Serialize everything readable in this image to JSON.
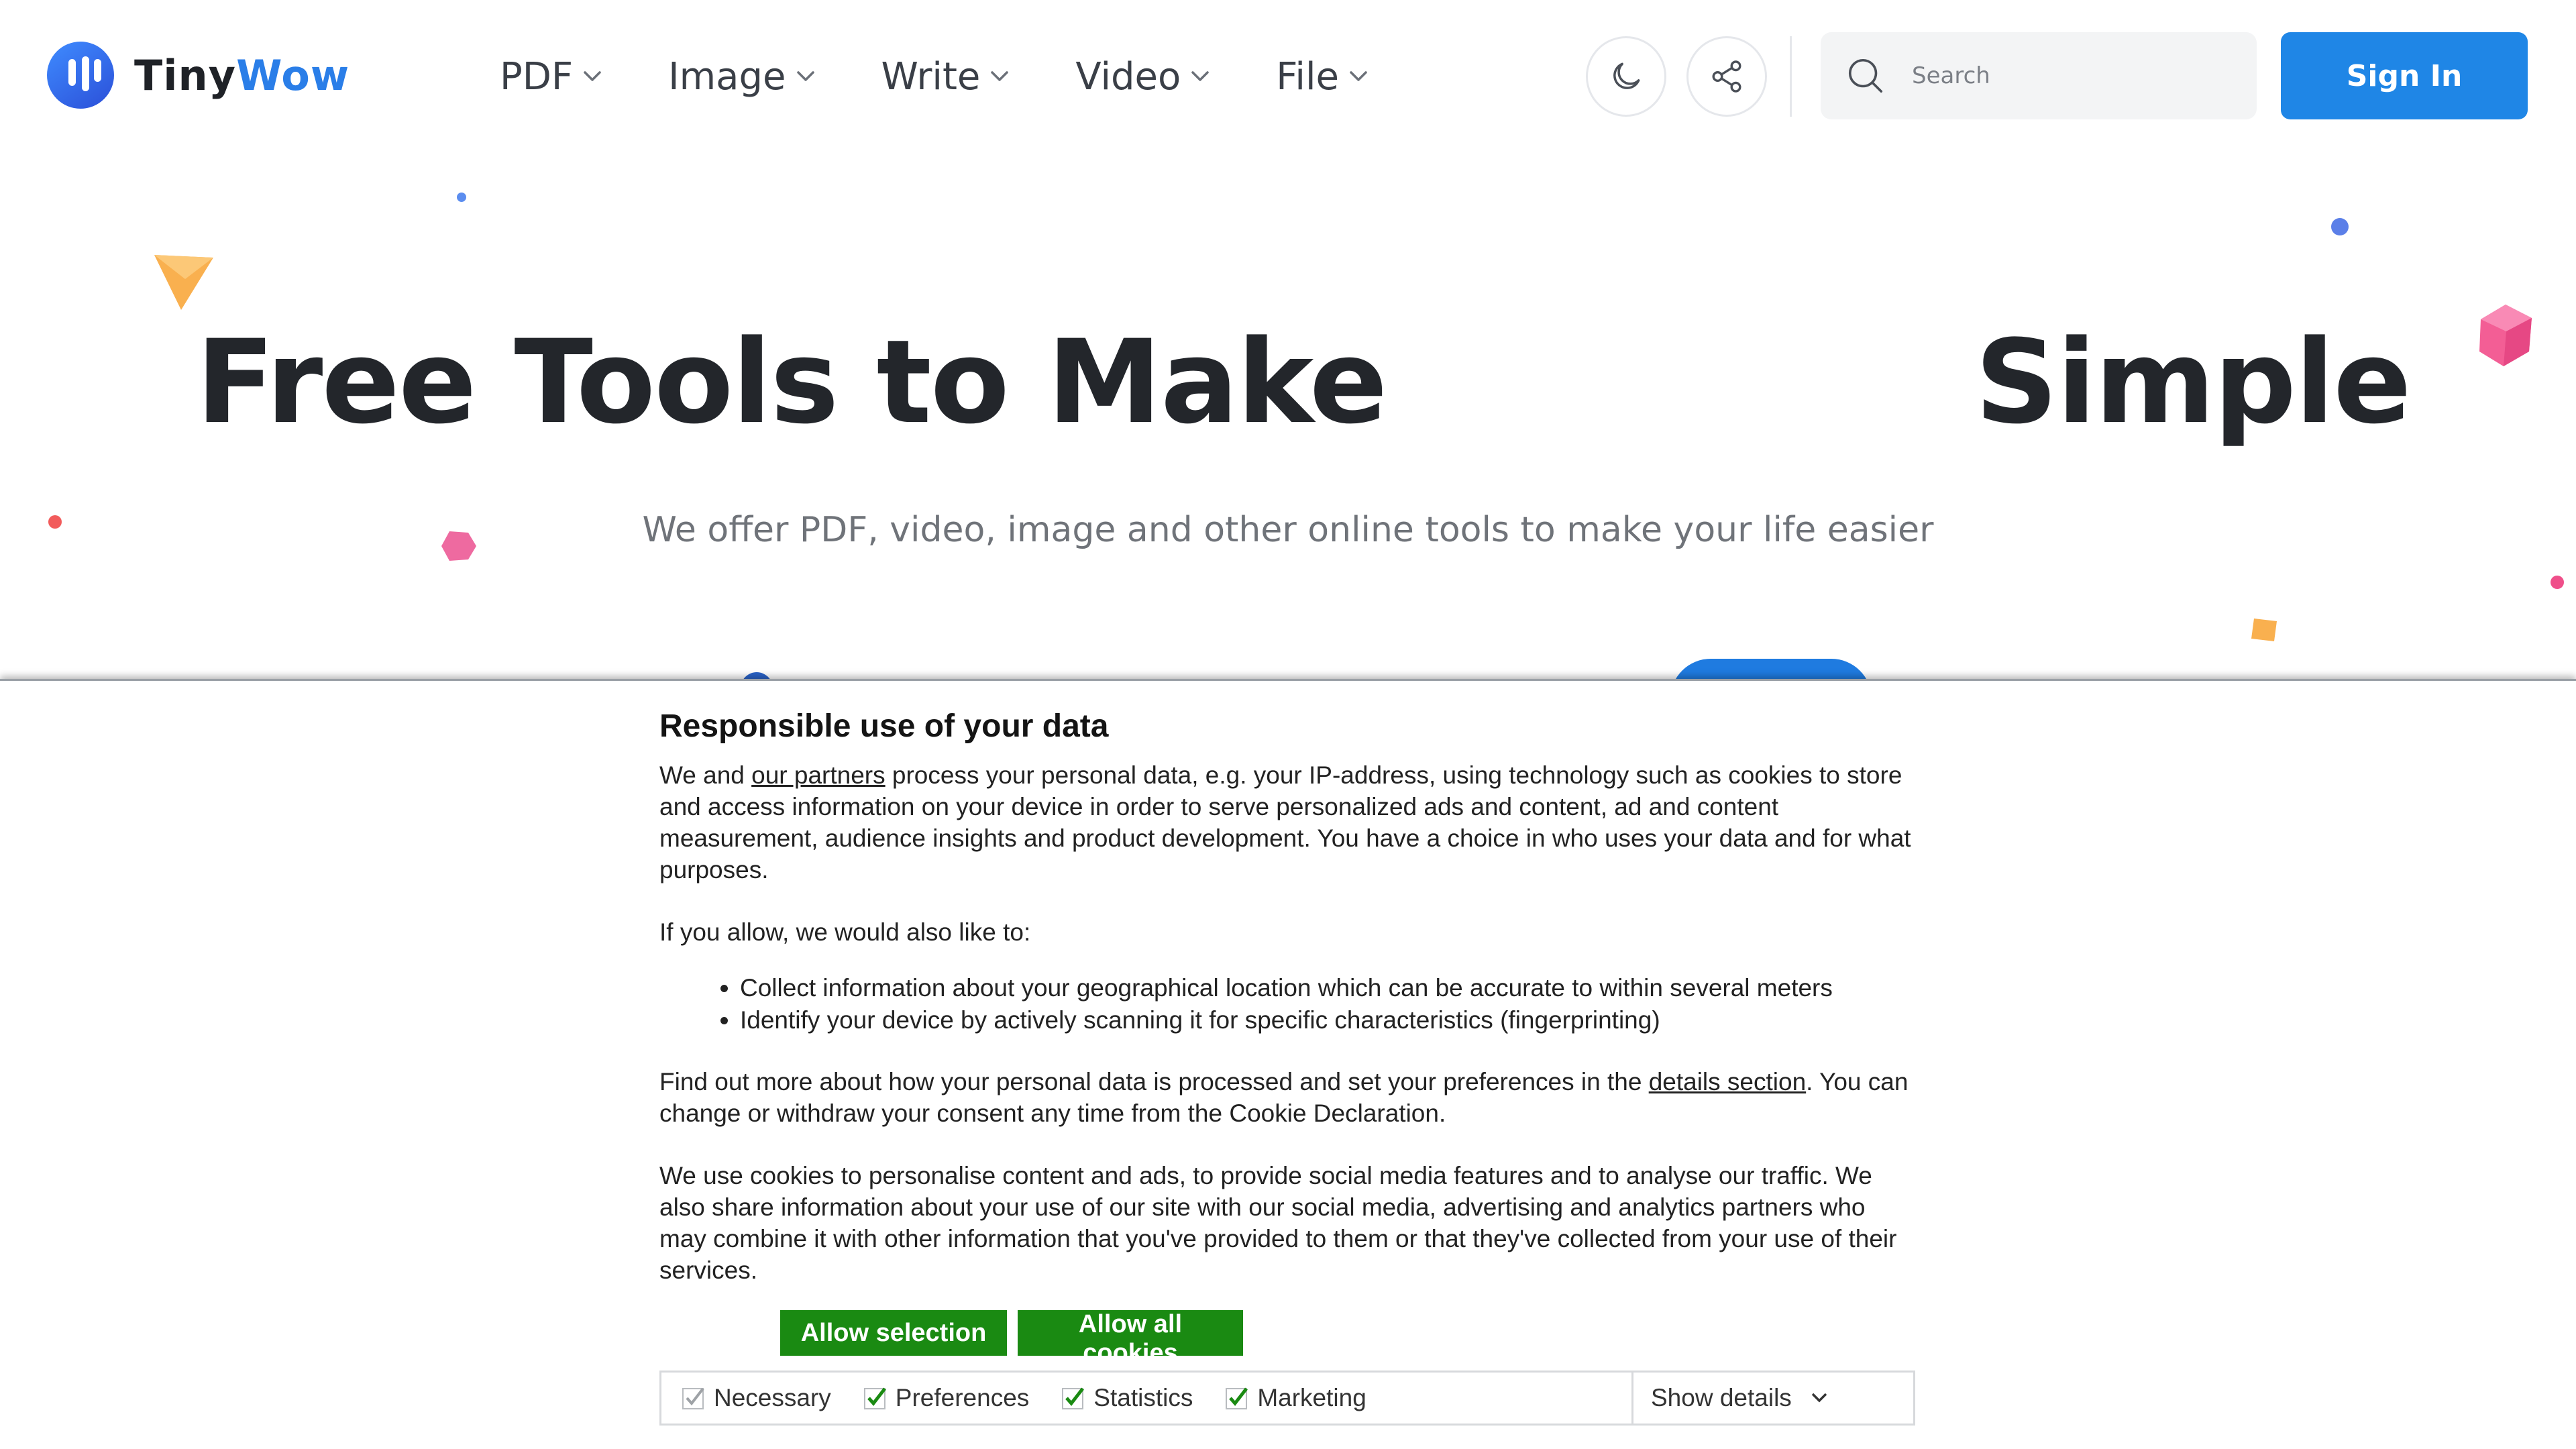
{
  "header": {
    "logo_prefix": "Tiny",
    "logo_suffix": "Wow",
    "nav": [
      {
        "label": "PDF"
      },
      {
        "label": "Image"
      },
      {
        "label": "Write"
      },
      {
        "label": "Video"
      },
      {
        "label": "File"
      }
    ],
    "search_placeholder": "Search",
    "signin_label": "Sign In"
  },
  "hero": {
    "title_left": "Free Tools to Make",
    "title_right": "Simple",
    "subtitle": "We offer PDF, video, image and other online tools to make your life easier"
  },
  "cookie": {
    "title": "Responsible use of your data",
    "p1_before": "We and ",
    "p1_link": "our partners",
    "p1_after": " process your personal data, e.g. your IP-address, using technology such as cookies to store and access information on your device in order to serve personalized ads and content, ad and content measurement, audience insights and product development. You have a choice in who uses your data and for what purposes.",
    "p2": "If you allow, we would also like to:",
    "bullets": [
      "Collect information about your geographical location which can be accurate to within several meters",
      "Identify your device by actively scanning it for specific characteristics (fingerprinting)"
    ],
    "p3_before": "Find out more about how your personal data is processed and set your preferences in the ",
    "p3_link": "details section",
    "p3_after": ". You can change or withdraw your consent any time from the Cookie Declaration.",
    "p4": "We use cookies to personalise content and ads, to provide social media features and to analyse our traffic. We also share information about your use of our site with our social media, advertising and analytics partners who may combine it with other information that you've provided to them or that they've collected from your use of their services.",
    "allow_selection": "Allow selection",
    "allow_all": "Allow all cookies",
    "checkboxes": [
      {
        "label": "Necessary",
        "checked": true,
        "disabled": true
      },
      {
        "label": "Preferences",
        "checked": true
      },
      {
        "label": "Statistics",
        "checked": true
      },
      {
        "label": "Marketing",
        "checked": true
      }
    ],
    "show_details": "Show details"
  },
  "colors": {
    "brand_blue": "#1f86e6",
    "accent_green": "#1a8a12",
    "title_dark": "#23262b"
  }
}
